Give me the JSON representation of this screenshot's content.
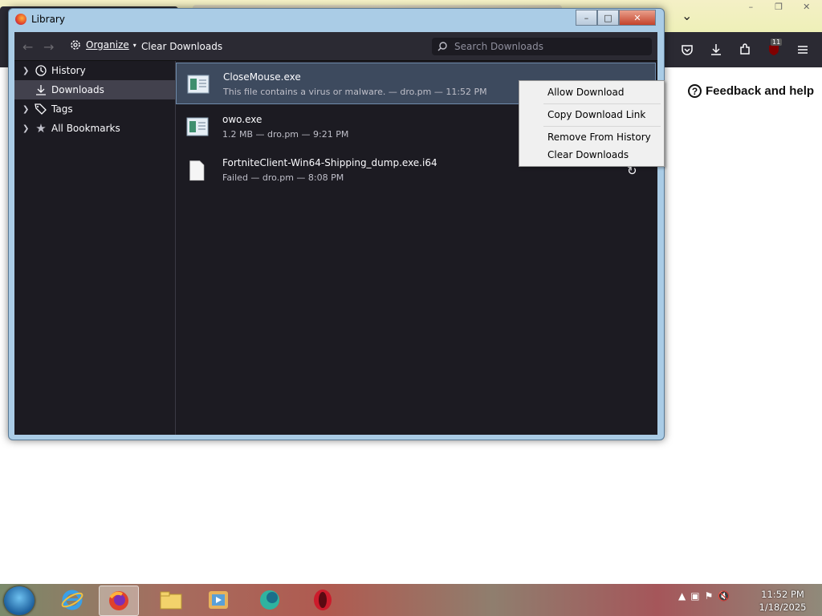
{
  "background_browser": {
    "feedback_label": "Feedback and help",
    "extension_badge": "11"
  },
  "library": {
    "title": "Library",
    "toolbar": {
      "organize_label": "Organize",
      "clear_downloads_label": "Clear Downloads",
      "search_placeholder": "Search Downloads"
    },
    "sidebar": [
      {
        "label": "History",
        "icon": "clock-icon"
      },
      {
        "label": "Downloads",
        "icon": "download-icon"
      },
      {
        "label": "Tags",
        "icon": "tag-icon"
      },
      {
        "label": "All Bookmarks",
        "icon": "star-icon"
      }
    ],
    "downloads": [
      {
        "name": "CloseMouse.exe",
        "status": "This file contains a virus or malware. — dro.pm — 11:52 PM"
      },
      {
        "name": "owo.exe",
        "status": "1.2 MB — dro.pm — 9:21 PM"
      },
      {
        "name": "FortniteClient-Win64-Shipping_dump.exe.i64",
        "status": "Failed — dro.pm — 8:08 PM"
      }
    ]
  },
  "context_menu": {
    "allow_download": "Allow Download",
    "copy_link": "Copy Download Link",
    "remove_history": "Remove From History",
    "clear_downloads": "Clear Downloads"
  },
  "taskbar": {
    "time": "11:52 PM",
    "date": "1/18/2025"
  },
  "colors": {
    "accent_selected": "#3d4a5e",
    "library_bg": "#1c1b22",
    "toolbar_bg": "#2b2a33"
  }
}
